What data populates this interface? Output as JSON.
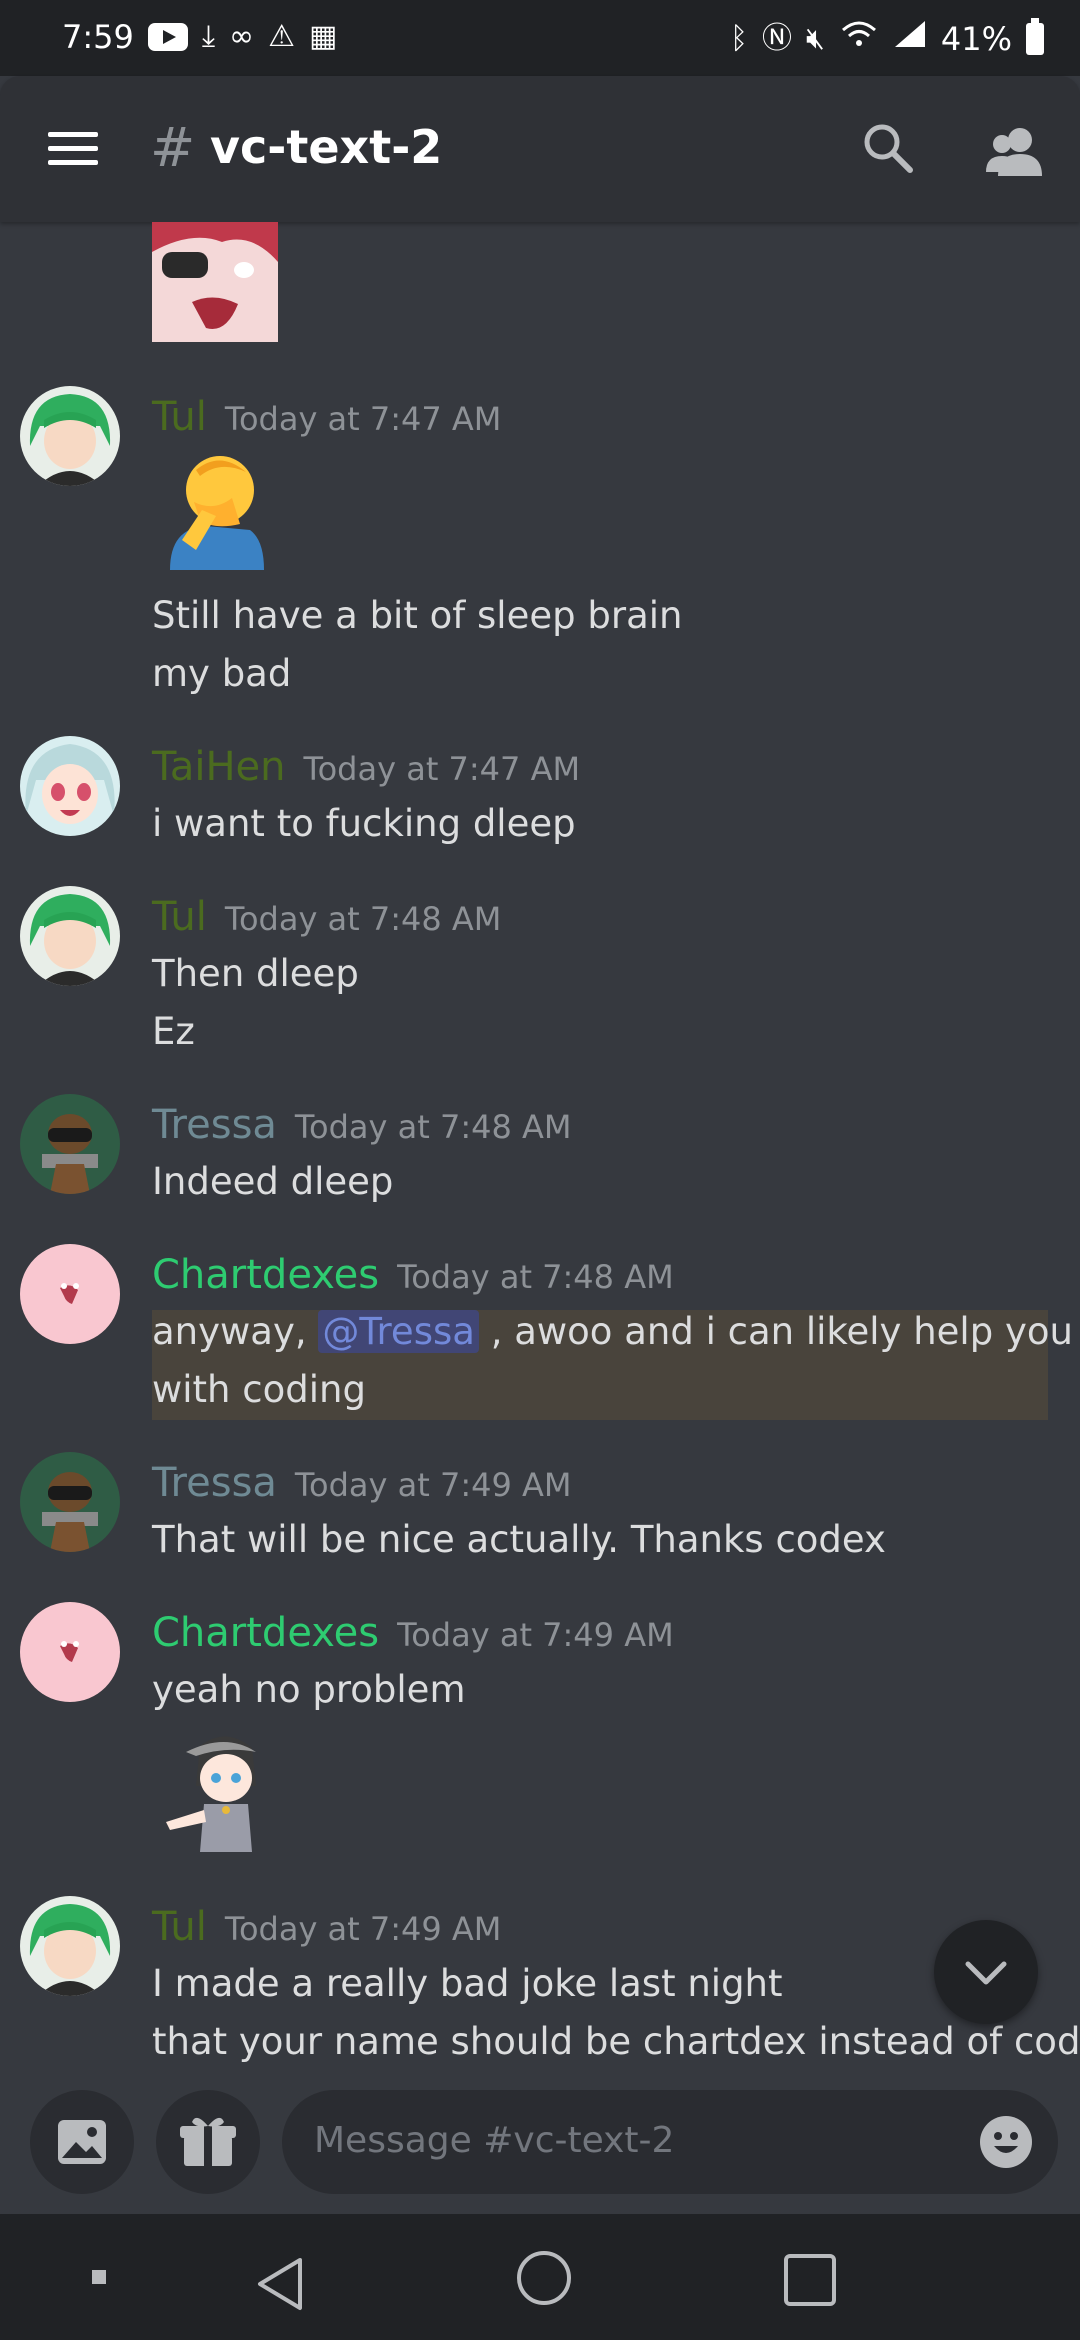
{
  "status_bar": {
    "time": "7:59",
    "battery": "41%"
  },
  "header": {
    "hash": "#",
    "channel": "vc-text-2",
    "icons": [
      "menu-icon",
      "search-icon",
      "members-icon"
    ]
  },
  "messages": [
    {
      "user": "Tul",
      "user_color": "#4b6b1f",
      "time": "Today at 7:47 AM",
      "lines": [
        "Still have a bit of sleep brain",
        "my bad"
      ],
      "emoji": "🤦‍♂️"
    },
    {
      "user": "TaiHen",
      "user_color": "#4b6b1f",
      "time": "Today at 7:47 AM",
      "lines": [
        "i want to fucking dleep"
      ]
    },
    {
      "user": "Tul",
      "user_color": "#4b6b1f",
      "time": "Today at 7:48 AM",
      "lines": [
        "Then dleep",
        "Ez"
      ]
    },
    {
      "user": "Tressa",
      "user_color": "#6f8a94",
      "time": "Today at 7:48 AM",
      "lines": [
        "Indeed dleep"
      ]
    },
    {
      "user": "Chartdexes",
      "user_color": "#2ecc71",
      "time": "Today at 7:48 AM",
      "line1_pre": "anyway, ",
      "mention": "@Tressa",
      "line1_post": " , awoo and i can likely help you out",
      "line2": "with coding"
    },
    {
      "user": "Tressa",
      "user_color": "#6f8a94",
      "time": "Today at 7:49 AM",
      "lines": [
        "That will be nice actually. Thanks codex"
      ]
    },
    {
      "user": "Chartdexes",
      "user_color": "#2ecc71",
      "time": "Today at 7:49 AM",
      "lines": [
        "yeah no problem"
      ]
    },
    {
      "user": "Tul",
      "user_color": "#4b6b1f",
      "time": "Today at 7:49 AM",
      "lines": [
        "I made a really bad joke last night",
        "that your name should be chartdex instead of codex"
      ]
    }
  ],
  "composer": {
    "placeholder": "Message #vc-text-2"
  },
  "colors": {
    "background": "#36393f",
    "header": "#2f3136",
    "mention_highlight": "#49443c",
    "mention_text": "#7289da"
  }
}
